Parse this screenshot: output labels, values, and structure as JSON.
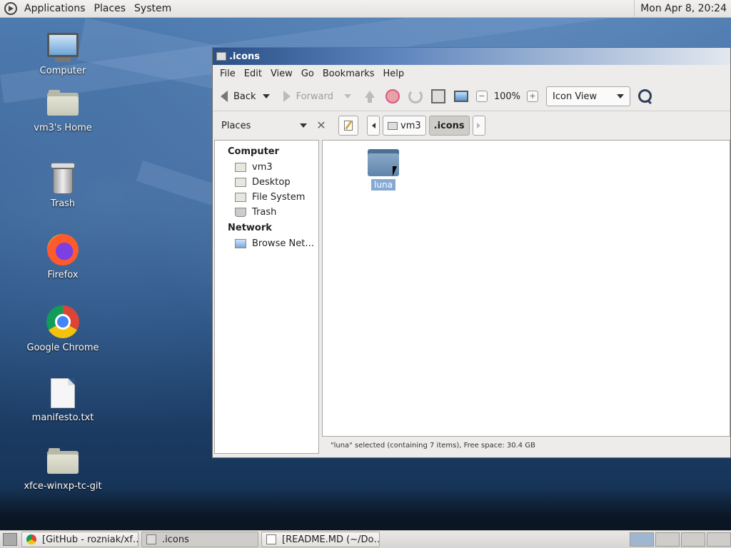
{
  "top_panel": {
    "menus": [
      "Applications",
      "Places",
      "System"
    ],
    "clock": "Mon Apr  8, 20:24"
  },
  "desktop": {
    "icons": [
      {
        "label": "Computer"
      },
      {
        "label": "vm3's Home"
      },
      {
        "label": "Trash"
      },
      {
        "label": "Firefox"
      },
      {
        "label": "Google Chrome"
      },
      {
        "label": "manifesto.txt"
      },
      {
        "label": "xfce-winxp-tc-git"
      }
    ]
  },
  "window": {
    "title": ".icons",
    "menubar": [
      "File",
      "Edit",
      "View",
      "Go",
      "Bookmarks",
      "Help"
    ],
    "toolbar": {
      "back": "Back",
      "forward": "Forward",
      "zoom": "100%",
      "view_mode": "Icon View"
    },
    "places_label": "Places",
    "breadcrumbs": [
      "vm3",
      ".icons"
    ],
    "sidebar": {
      "computer_heading": "Computer",
      "computer_items": [
        "vm3",
        "Desktop",
        "File System",
        "Trash"
      ],
      "network_heading": "Network",
      "network_items": [
        "Browse Net…"
      ]
    },
    "files": [
      {
        "name": "luna",
        "selected": true
      }
    ],
    "status": "\"luna\" selected (containing 7 items), Free space: 30.4 GB"
  },
  "taskbar": {
    "tasks": [
      {
        "label": "[GitHub - rozniak/xf…",
        "active": false
      },
      {
        "label": ".icons",
        "active": true
      },
      {
        "label": "[README.MD (~/Do…",
        "active": false
      }
    ]
  }
}
